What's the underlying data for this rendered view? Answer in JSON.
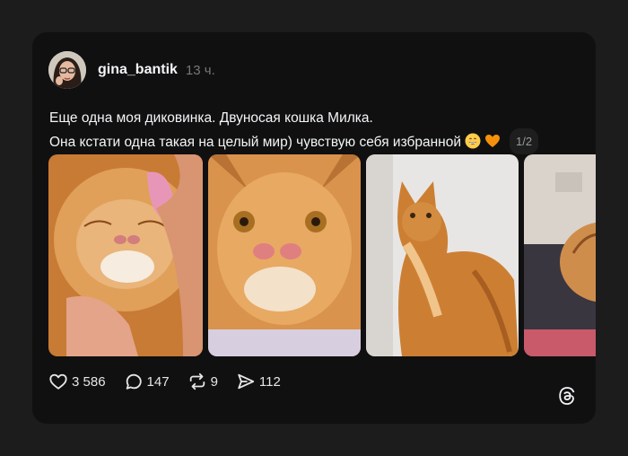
{
  "post": {
    "username": "gina_bantik",
    "time": "13 ч.",
    "text_line1": "Еще одна моя диковинка. Двуносая кошка Милка.",
    "text_line2": "Она кстати одна такая на целый мир) чувствую себя избранной",
    "emojis": [
      "grinning-face-emoji",
      "orange-heart-emoji"
    ],
    "page_counter": "1/2"
  },
  "actions": {
    "likes": "3 586",
    "comments": "147",
    "reposts": "9",
    "shares": "112"
  },
  "icons": [
    "heart-icon",
    "comment-icon",
    "repost-icon",
    "share-icon",
    "threads-logo-icon"
  ],
  "colors": {
    "background": "#1c1c1c",
    "card": "#101010",
    "text": "#f3f5f7",
    "muted": "#777777",
    "cat_orange": "#d9822b"
  }
}
